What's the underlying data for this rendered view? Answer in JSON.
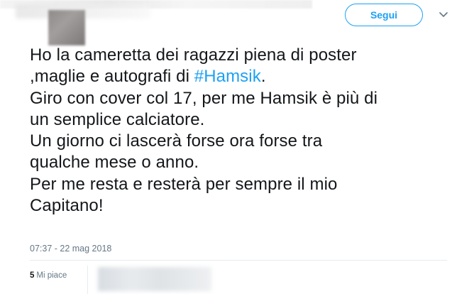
{
  "header": {
    "follow_label": "Segui",
    "chevron_icon": "chevron-down-icon",
    "accent_color": "#1da1f2"
  },
  "tweet": {
    "lines": [
      {
        "text": "Ho la cameretta dei ragazzi piena di poster"
      },
      {
        "before": ",maglie e autografi di ",
        "hashtag": "#Hamsik",
        "after": "."
      },
      {
        "text": "Giro con cover col 17, per me Hamsik è più di"
      },
      {
        "text": "un semplice calciatore."
      },
      {
        "text": "Un giorno ci lascerà forse ora forse tra"
      },
      {
        "text": "qualche mese o anno."
      },
      {
        "text": "Per me resta e resterà per sempre il mio"
      },
      {
        "text": "Capitano!"
      }
    ],
    "timestamp": "07:37 - 22 mag 2018"
  },
  "stats": {
    "likes_count": "5",
    "likes_label": "Mi piace"
  }
}
